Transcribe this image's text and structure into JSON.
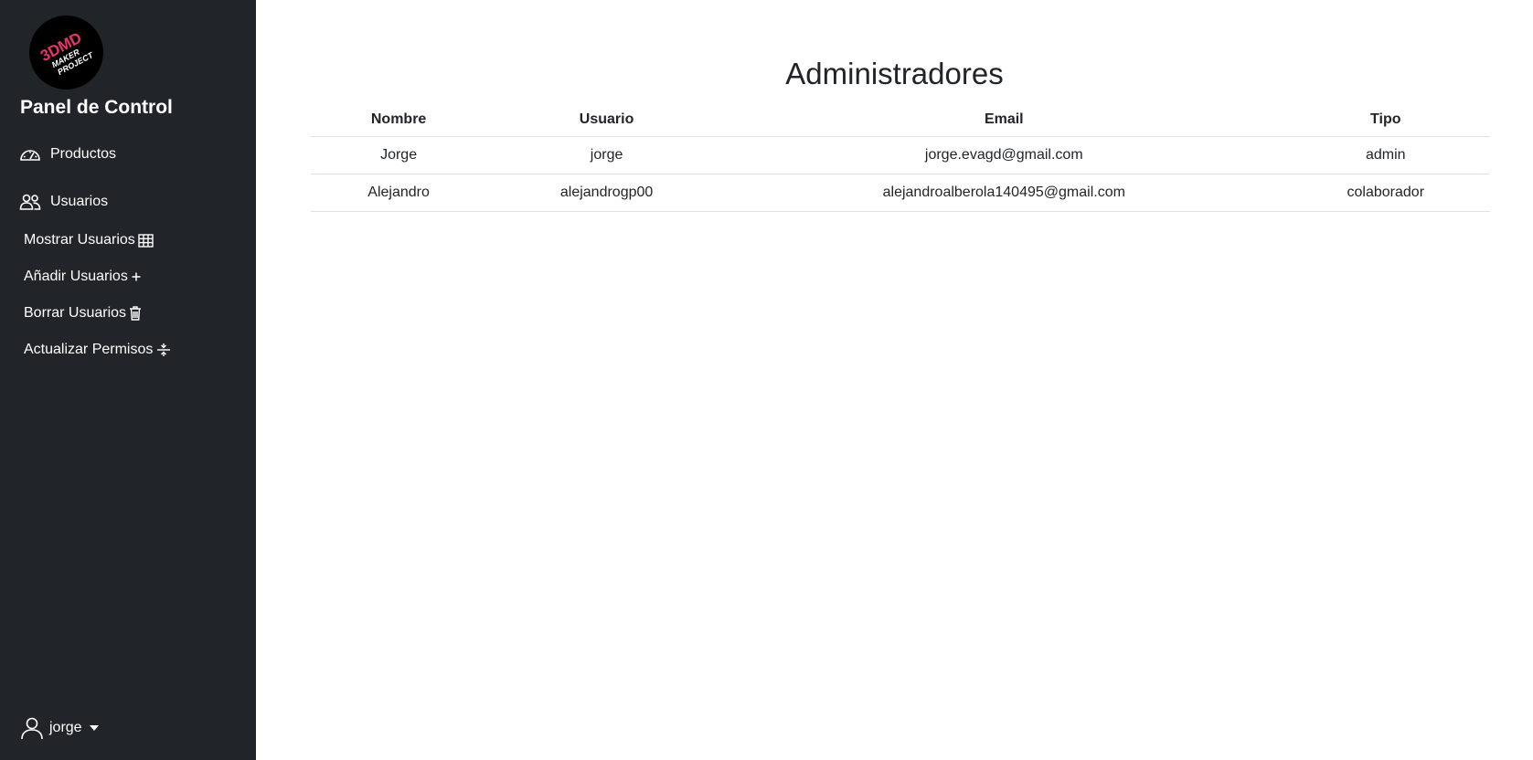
{
  "sidebar": {
    "logo": {
      "line1": "3DMD",
      "line2": "MAKER",
      "line3": "PROJECT",
      "colors": [
        "#e8336d",
        "#3fb7e8",
        "#ffffff"
      ]
    },
    "title": "Panel de Control",
    "nav": {
      "productos": {
        "label": "Productos",
        "icon": "speedometer-icon"
      },
      "usuarios": {
        "label": "Usuarios",
        "icon": "people-icon"
      }
    },
    "sub_items": [
      {
        "label": "Mostrar Usuarios",
        "icon": "table-icon"
      },
      {
        "label": "Añadir Usuarios",
        "icon": "plus-icon"
      },
      {
        "label": "Borrar Usuarios",
        "icon": "trash-icon"
      },
      {
        "label": "Actualizar Permisos",
        "icon": "arrows-collapse-icon"
      }
    ],
    "user": {
      "name": "jorge",
      "icon": "person-icon"
    }
  },
  "main": {
    "title": "Administradores",
    "table": {
      "headers": [
        "Nombre",
        "Usuario",
        "Email",
        "Tipo"
      ],
      "rows": [
        [
          "Jorge",
          "jorge",
          "jorge.evagd@gmail.com",
          "admin"
        ],
        [
          "Alejandro",
          "alejandrogp00",
          "alejandroalberola140495@gmail.com",
          "colaborador"
        ]
      ]
    }
  },
  "colors": {
    "sidebar_bg": "#212529",
    "text_dark": "#212529",
    "table_border": "#dee2e6"
  }
}
